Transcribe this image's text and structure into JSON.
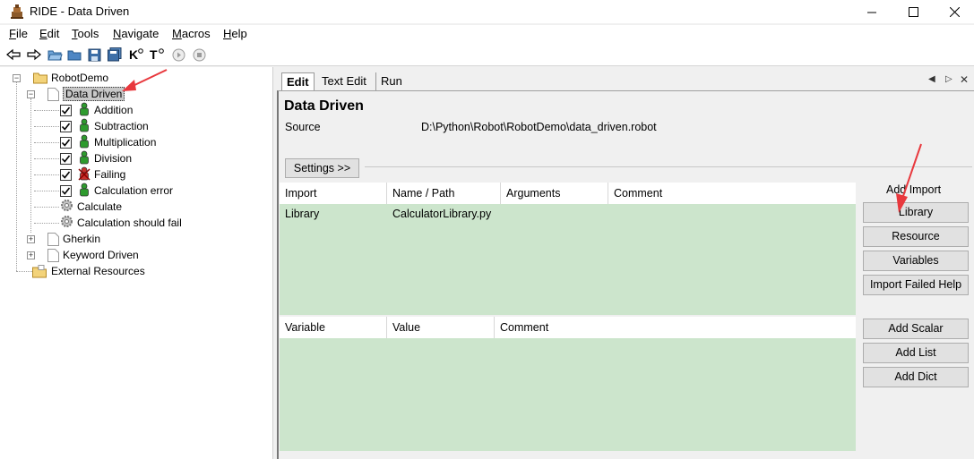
{
  "window": {
    "title": "RIDE - Data Driven",
    "controls": {
      "minimize": "—",
      "maximize": "☐",
      "close": "✕"
    }
  },
  "menubar": [
    "File",
    "Edit",
    "Tools",
    "Navigate",
    "Macros",
    "Help"
  ],
  "toolbar": [
    {
      "icon": "back-arrow-icon"
    },
    {
      "icon": "forward-arrow-icon"
    },
    {
      "icon": "open-folder-icon"
    },
    {
      "icon": "open-directory-icon"
    },
    {
      "icon": "save-icon"
    },
    {
      "icon": "save-all-icon"
    },
    {
      "icon": "search-keywords-icon",
      "label": "K"
    },
    {
      "icon": "search-tests-icon",
      "label": "T"
    },
    {
      "icon": "run-icon"
    },
    {
      "icon": "stop-icon"
    }
  ],
  "tree": {
    "root": "RobotDemo",
    "selected_suite": "Data Driven",
    "tests": [
      {
        "label": "Addition",
        "checked": true,
        "status": "pass"
      },
      {
        "label": "Subtraction",
        "checked": true,
        "status": "pass"
      },
      {
        "label": "Multiplication",
        "checked": true,
        "status": "pass"
      },
      {
        "label": "Division",
        "checked": true,
        "status": "pass"
      },
      {
        "label": "Failing",
        "checked": true,
        "status": "fail"
      },
      {
        "label": "Calculation error",
        "checked": true,
        "status": "pass"
      }
    ],
    "keywords": [
      "Calculate",
      "Calculation should fail"
    ],
    "other_suites": [
      "Gherkin",
      "Keyword Driven"
    ],
    "external": "External Resources"
  },
  "tabs": [
    "Edit",
    "Text Edit",
    "Run"
  ],
  "editor": {
    "suite_name": "Data Driven",
    "source_label": "Source",
    "source_value": "D:\\Python\\Robot\\RobotDemo\\data_driven.robot",
    "settings_button": "Settings >>",
    "import_table": {
      "headers": [
        "Import",
        "Name / Path",
        "Arguments",
        "Comment"
      ],
      "rows": [
        [
          "Library",
          "CalculatorLibrary.py",
          "",
          ""
        ]
      ]
    },
    "variable_table": {
      "headers": [
        "Variable",
        "Value",
        "Comment"
      ],
      "rows": []
    },
    "side": {
      "title": "Add Import",
      "import_buttons": [
        "Library",
        "Resource",
        "Variables",
        "Import Failed Help"
      ],
      "variable_buttons": [
        "Add Scalar",
        "Add List",
        "Add Dict"
      ]
    }
  },
  "colors": {
    "table_bg": "#cce5cc",
    "annotation_arrow": "#e8383d",
    "selected_bg": "#c8c8c8"
  }
}
